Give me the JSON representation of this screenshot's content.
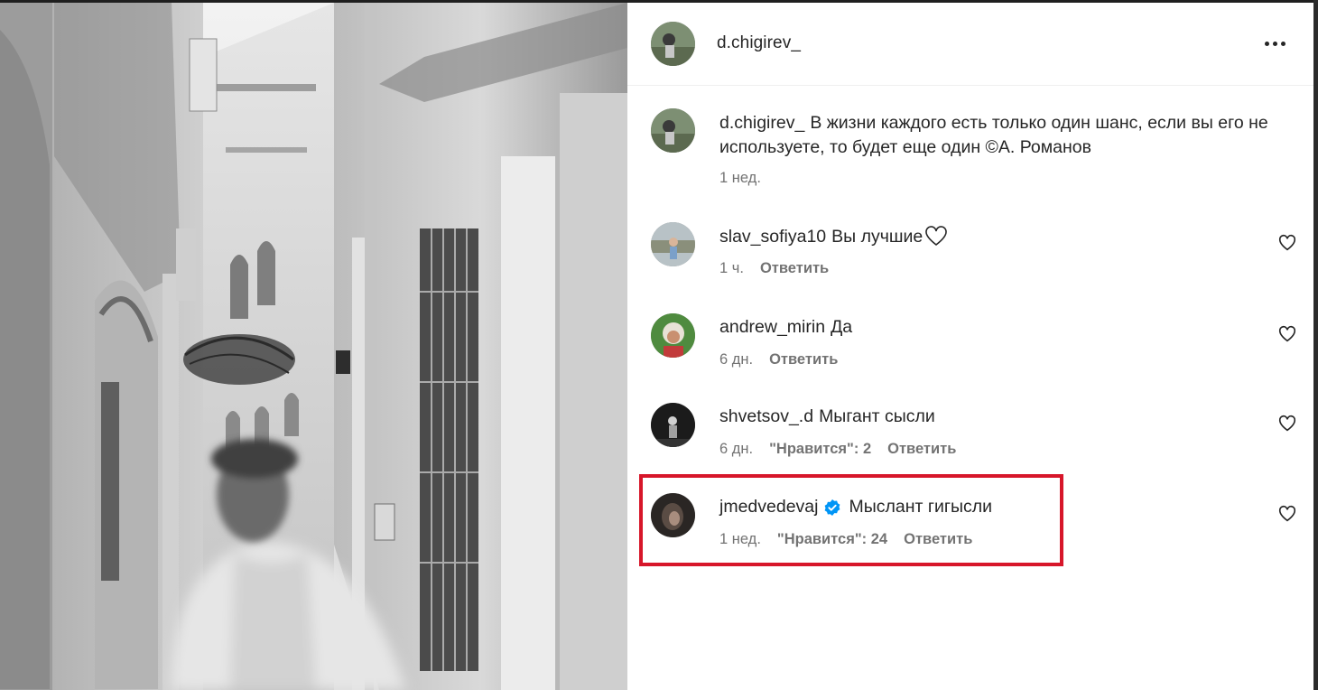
{
  "post": {
    "author": "d.chigirev_",
    "caption_user": "d.chigirev_",
    "caption_text": "В жизни каждого есть только один шанс, если вы его не используете, то будет еще один ©А. Романов",
    "caption_time": "1 нед."
  },
  "comments": [
    {
      "user": "slav_sofiya10",
      "text": "Вы лучшие",
      "time": "1 ч.",
      "likes": "",
      "reply": "Ответить",
      "has_inline_heart": true
    },
    {
      "user": "andrew_mirin",
      "text": "Да",
      "time": "6 дн.",
      "likes": "",
      "reply": "Ответить"
    },
    {
      "user": "shvetsov_.d",
      "text": "Мыгант сысли",
      "time": "6 дн.",
      "likes": "\"Нравится\": 2",
      "reply": "Ответить"
    },
    {
      "user": "jmedvedevaj",
      "text": "Мыслант гигысли",
      "time": "1 нед.",
      "likes": "\"Нравится\": 24",
      "reply": "Ответить",
      "verified": true,
      "highlighted": true
    }
  ],
  "icons": {
    "more": "more-horizontal-icon",
    "like": "heart-outline-icon",
    "verified": "verified-badge-icon"
  },
  "colors": {
    "highlight_border": "#d7162a",
    "verified_blue": "#0095f6",
    "secondary_text": "#737373"
  }
}
